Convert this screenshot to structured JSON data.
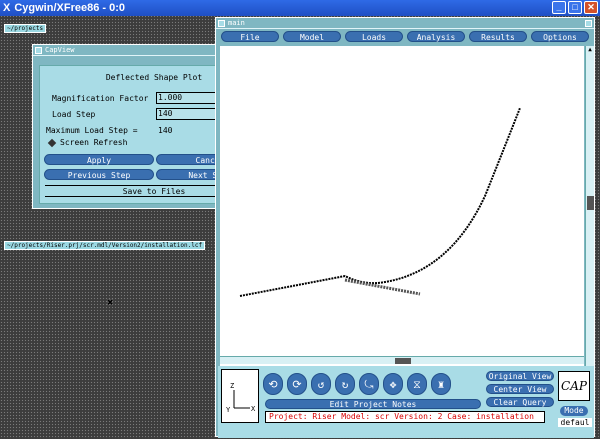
{
  "app": {
    "title": "Cygwin/XFree86 - 0:0",
    "logo": "X"
  },
  "titlebar_buttons": {
    "minimize": "_",
    "maximize": "□",
    "close": "✕"
  },
  "desktop": {
    "label_projects": "~/projects",
    "label_path": "~/projects/Riser.prj/scr.mdl/Version2/installation.lcf",
    "cursor": "✖"
  },
  "capview": {
    "title": "CapView",
    "heading": "Deflected Shape Plot",
    "magnification_label": "Magnification Factor",
    "magnification_value": "1.000",
    "load_step_label": "Load Step",
    "load_step_value": "140",
    "max_load_label": "Maximum Load Step =",
    "max_load_value": "140",
    "screen_refresh_label": "Screen Refresh",
    "apply": "Apply",
    "cancel": "Cancel",
    "previous_step": "Previous Step",
    "next_step": "Next Step",
    "save_to_files": "Save to Files"
  },
  "main": {
    "title": "main",
    "menu": [
      "File",
      "Model",
      "Loads",
      "Analysis",
      "Results",
      "Options"
    ],
    "axes_label": "Z\nY X",
    "edit_notes": "Edit Project Notes",
    "original_view": "Original View",
    "center_view": "Center View",
    "clear_query": "Clear Query",
    "status": "Project: Riser  Model: scr  Version: 2  Case: installation",
    "logo": "CAP",
    "mode_label": "Mode",
    "mode_value": "defaul",
    "view_icons": [
      "rotate-x-icon",
      "rotate-y-icon",
      "rotate-z-icon",
      "rotate-xy-icon",
      "rotate-free-icon",
      "pan-icon",
      "zoom-icon",
      "reset-icon"
    ]
  },
  "colors": {
    "dialog_bg": "#a9dce6",
    "button": "#3a6fb0",
    "status_text": "#d80000"
  }
}
